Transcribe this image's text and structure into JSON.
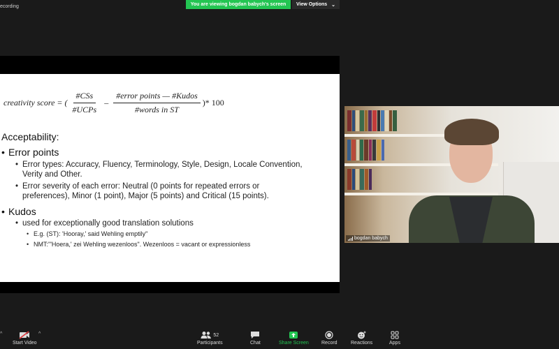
{
  "top_bar": {
    "recording_label": "ecording",
    "share_banner": "You are viewing bogdan babych's screen",
    "view_options": "View Options",
    "view_options_caret": "⌄"
  },
  "slide": {
    "formula": {
      "lhs": "creativity score = (",
      "frac1_num": "#CSs",
      "frac1_den": "#UCPs",
      "minus": "–",
      "frac2_num": "#error points — #Kudos",
      "frac2_den": "#words in ST",
      "tail": ")* 100"
    },
    "heading": "Acceptability:",
    "bullet_error_points": "Error points",
    "error_types_line1": "Error types: Accuracy, Fluency, Terminology, Style, Design, Locale Convention,",
    "error_types_line2": "Verity and Other.",
    "error_severity_line1": "Error severity of each error: Neutral (0 points for repeated errors or",
    "error_severity_line2": "preferences), Minor (1 point), Major (5 points) and Critical (15 points).",
    "bullet_kudos": "Kudos",
    "kudos_sub": "used for exceptionally good translation solutions",
    "example_st": "E.g. (ST): 'Hooray,' said Wehling emptily\"",
    "example_nmt": "NMT:\"'Hoera,' zei Wehling wezenloos\". Wezenloos = vacant or expressionless",
    "bullet_char_l1": "•",
    "bullet_char_l2": "•",
    "bullet_char_l3": "•"
  },
  "participant": {
    "name": "bogdan babych"
  },
  "toolbar": {
    "start_video": "Start Video",
    "participants": "Participants",
    "participants_count": "52",
    "chat": "Chat",
    "share_screen": "Share Screen",
    "record": "Record",
    "reactions": "Reactions",
    "apps": "Apps",
    "caret_up": "^"
  },
  "colors": {
    "share_green": "#23c552",
    "background": "#1a1a1a"
  }
}
